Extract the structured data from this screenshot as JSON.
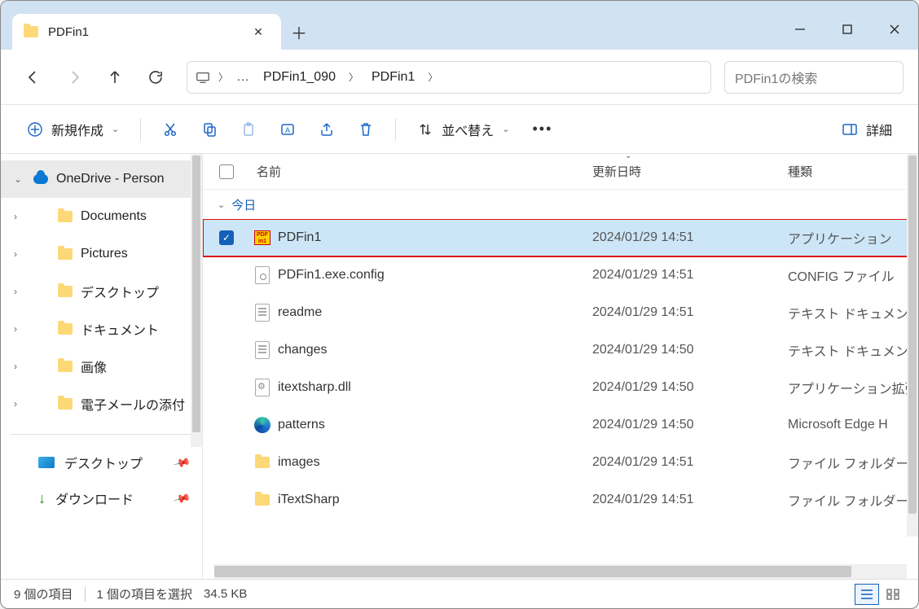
{
  "tab": {
    "title": "PDFin1"
  },
  "breadcrumb": {
    "seg1": "PDFin1_090",
    "seg2": "PDFin1",
    "more": "…"
  },
  "search": {
    "placeholder": "PDFin1の検索"
  },
  "toolbar": {
    "new": "新規作成",
    "sort": "並べ替え",
    "details": "詳細"
  },
  "sidebar": {
    "onedrive": "OneDrive - Person",
    "items": [
      "Documents",
      "Pictures",
      "デスクトップ",
      "ドキュメント",
      "画像",
      "電子メールの添付"
    ],
    "quick": {
      "desktop": "デスクトップ",
      "downloads": "ダウンロード"
    }
  },
  "columns": {
    "name": "名前",
    "date": "更新日時",
    "type": "種類"
  },
  "group": {
    "today": "今日"
  },
  "files": [
    {
      "name": "PDFin1",
      "date": "2024/01/29 14:51",
      "type": "アプリケーション",
      "icon": "pdf",
      "selected": true
    },
    {
      "name": "PDFin1.exe.config",
      "date": "2024/01/29 14:51",
      "type": "CONFIG ファイル",
      "icon": "cfg"
    },
    {
      "name": "readme",
      "date": "2024/01/29 14:51",
      "type": "テキスト ドキュメント",
      "icon": "txt"
    },
    {
      "name": "changes",
      "date": "2024/01/29 14:50",
      "type": "テキスト ドキュメント",
      "icon": "txt"
    },
    {
      "name": "itextsharp.dll",
      "date": "2024/01/29 14:50",
      "type": "アプリケーション拡張",
      "icon": "dll"
    },
    {
      "name": "patterns",
      "date": "2024/01/29 14:50",
      "type": "Microsoft Edge H",
      "icon": "edge"
    },
    {
      "name": "images",
      "date": "2024/01/29 14:51",
      "type": "ファイル フォルダー",
      "icon": "folder"
    },
    {
      "name": "iTextSharp",
      "date": "2024/01/29 14:51",
      "type": "ファイル フォルダー",
      "icon": "folder"
    }
  ],
  "status": {
    "count": "9 個の項目",
    "selected": "1 個の項目を選択",
    "size": "34.5 KB"
  }
}
